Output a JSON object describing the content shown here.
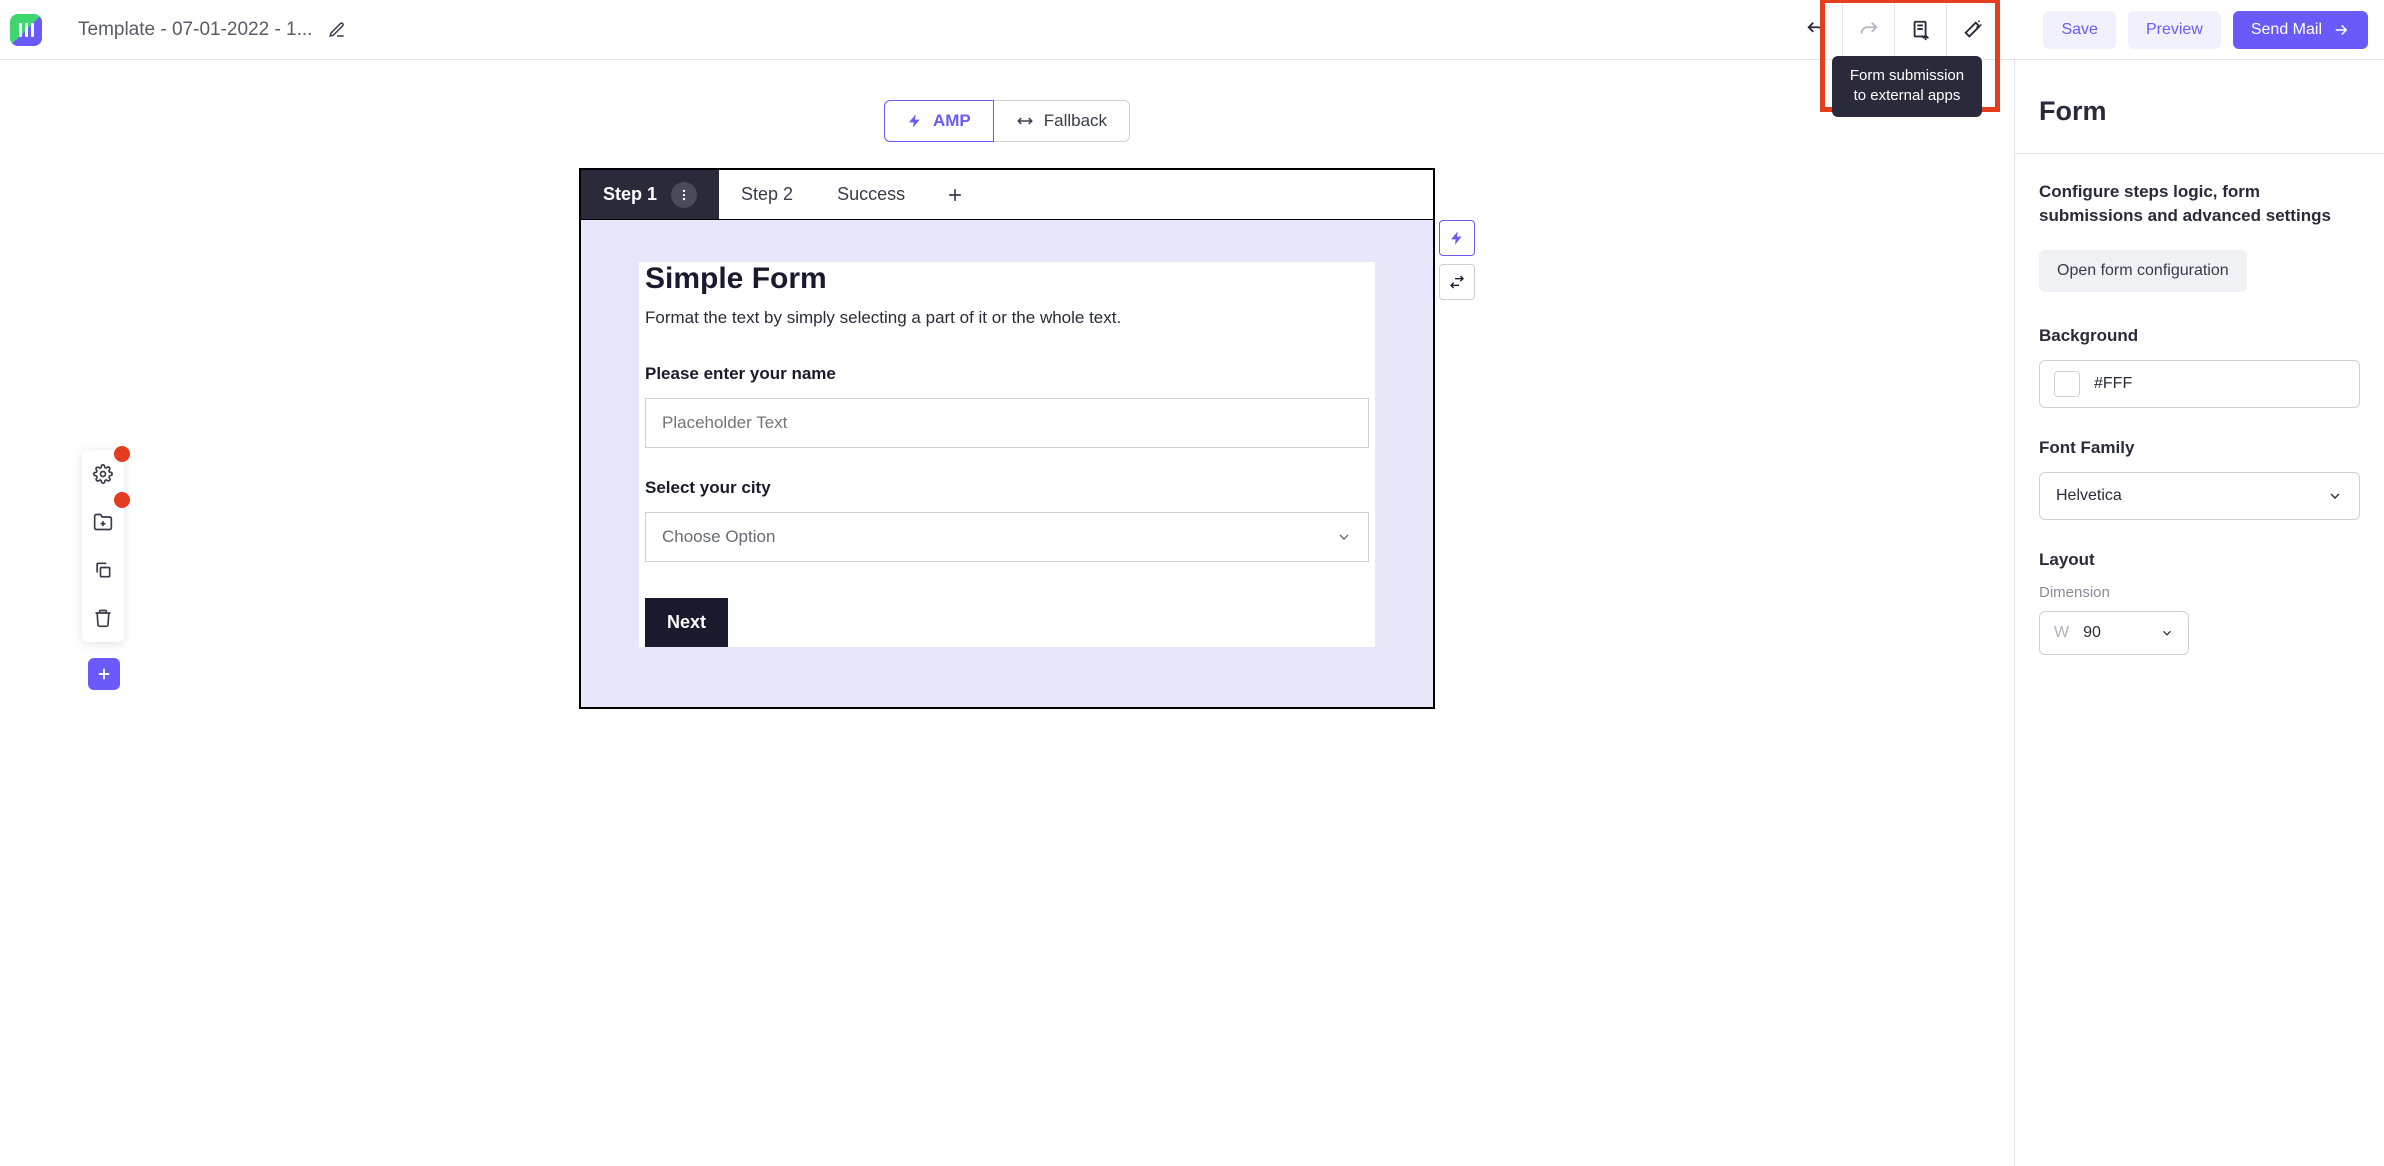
{
  "topbar": {
    "template_name": "Template - 07-01-2022 - 1...",
    "tooltip": "Form submission to external apps",
    "actions": {
      "save": "Save",
      "preview": "Preview",
      "send_mail": "Send Mail"
    }
  },
  "modes": {
    "amp": "AMP",
    "fallback": "Fallback"
  },
  "steps": {
    "step1": "Step 1",
    "step2": "Step 2",
    "success": "Success"
  },
  "form": {
    "title": "Simple Form",
    "description": "Format the text by simply selecting a part of it or the whole text.",
    "name_label": "Please enter your name",
    "name_placeholder": "Placeholder Text",
    "city_label": "Select your city",
    "city_placeholder": "Choose Option",
    "next": "Next"
  },
  "panel": {
    "title": "Form",
    "description": "Configure steps logic, form submissions and advanced settings",
    "config_btn": "Open form configuration",
    "background_label": "Background",
    "background_value": "#FFF",
    "font_label": "Font Family",
    "font_value": "Helvetica",
    "layout_label": "Layout",
    "dimension_label": "Dimension",
    "dimension_prefix": "W",
    "dimension_value": "90"
  }
}
